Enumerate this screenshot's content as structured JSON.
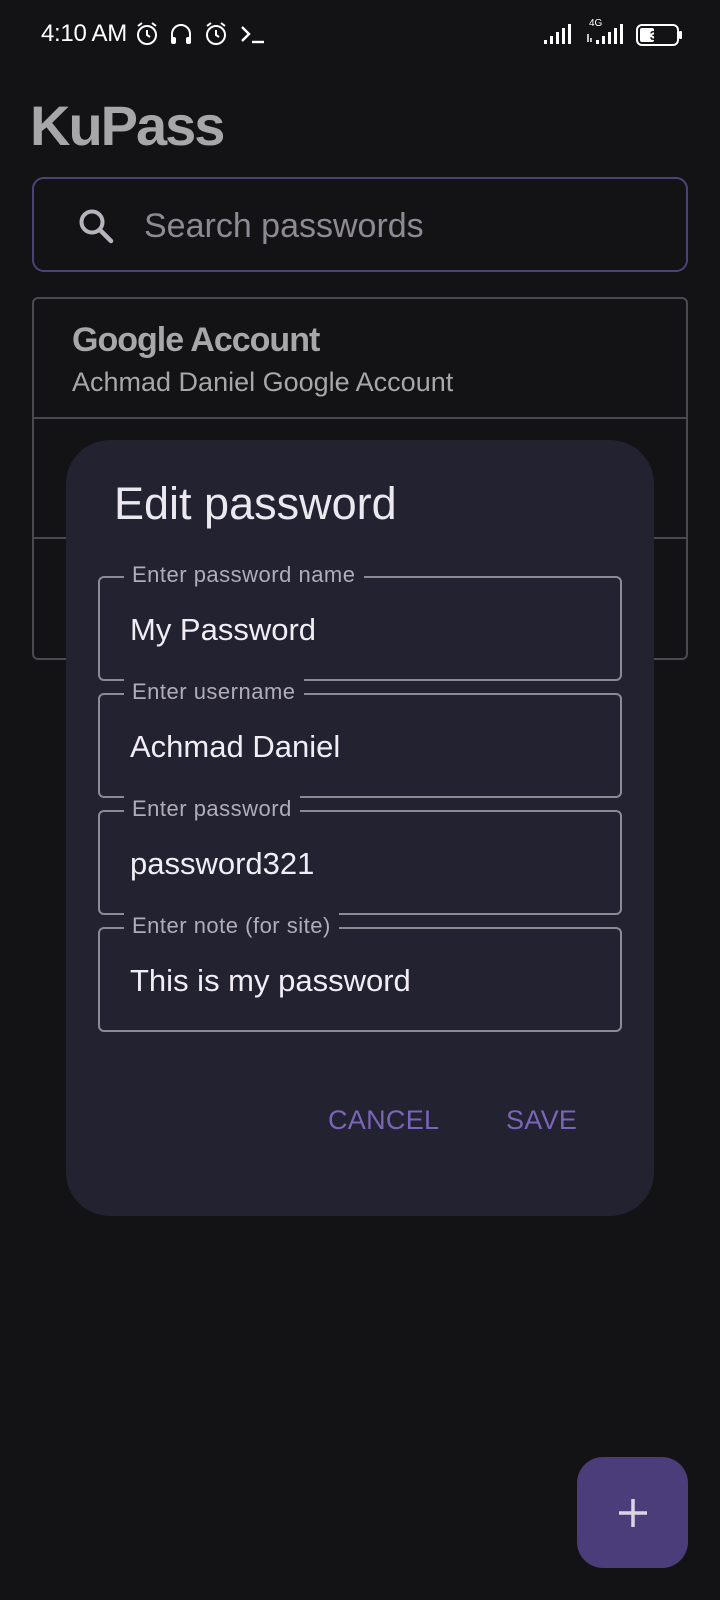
{
  "status_bar": {
    "time": "4:10 AM",
    "network": "4G",
    "battery": "34",
    "icons": [
      "alarm-icon",
      "headset-icon",
      "alarm-icon",
      "terminal-icon",
      "signal-icon",
      "signal-4g-icon",
      "battery-icon"
    ]
  },
  "app": {
    "title": "KuPass"
  },
  "search": {
    "placeholder": "Search passwords",
    "icon": "search-icon"
  },
  "list": {
    "items": [
      {
        "name": "Google Account",
        "username": "Achmad Daniel Google Account"
      },
      {
        "name": "",
        "username": ""
      },
      {
        "name": "",
        "username": ""
      }
    ]
  },
  "dialog": {
    "title": "Edit password",
    "fields": [
      {
        "label": "Enter password name",
        "value": "My Password"
      },
      {
        "label": "Enter username",
        "value": "Achmad Daniel"
      },
      {
        "label": "Enter password",
        "value": "password321"
      },
      {
        "label": "Enter note (for site)",
        "value": "This is my password"
      }
    ],
    "cancel_label": "CANCEL",
    "save_label": "SAVE"
  },
  "fab": {
    "icon": "plus-icon"
  },
  "colors": {
    "background": "#131315",
    "dialog": "#232231",
    "accent": "#7a65b8",
    "fab": "#4b3c7a",
    "search_border": "#4c4277"
  }
}
